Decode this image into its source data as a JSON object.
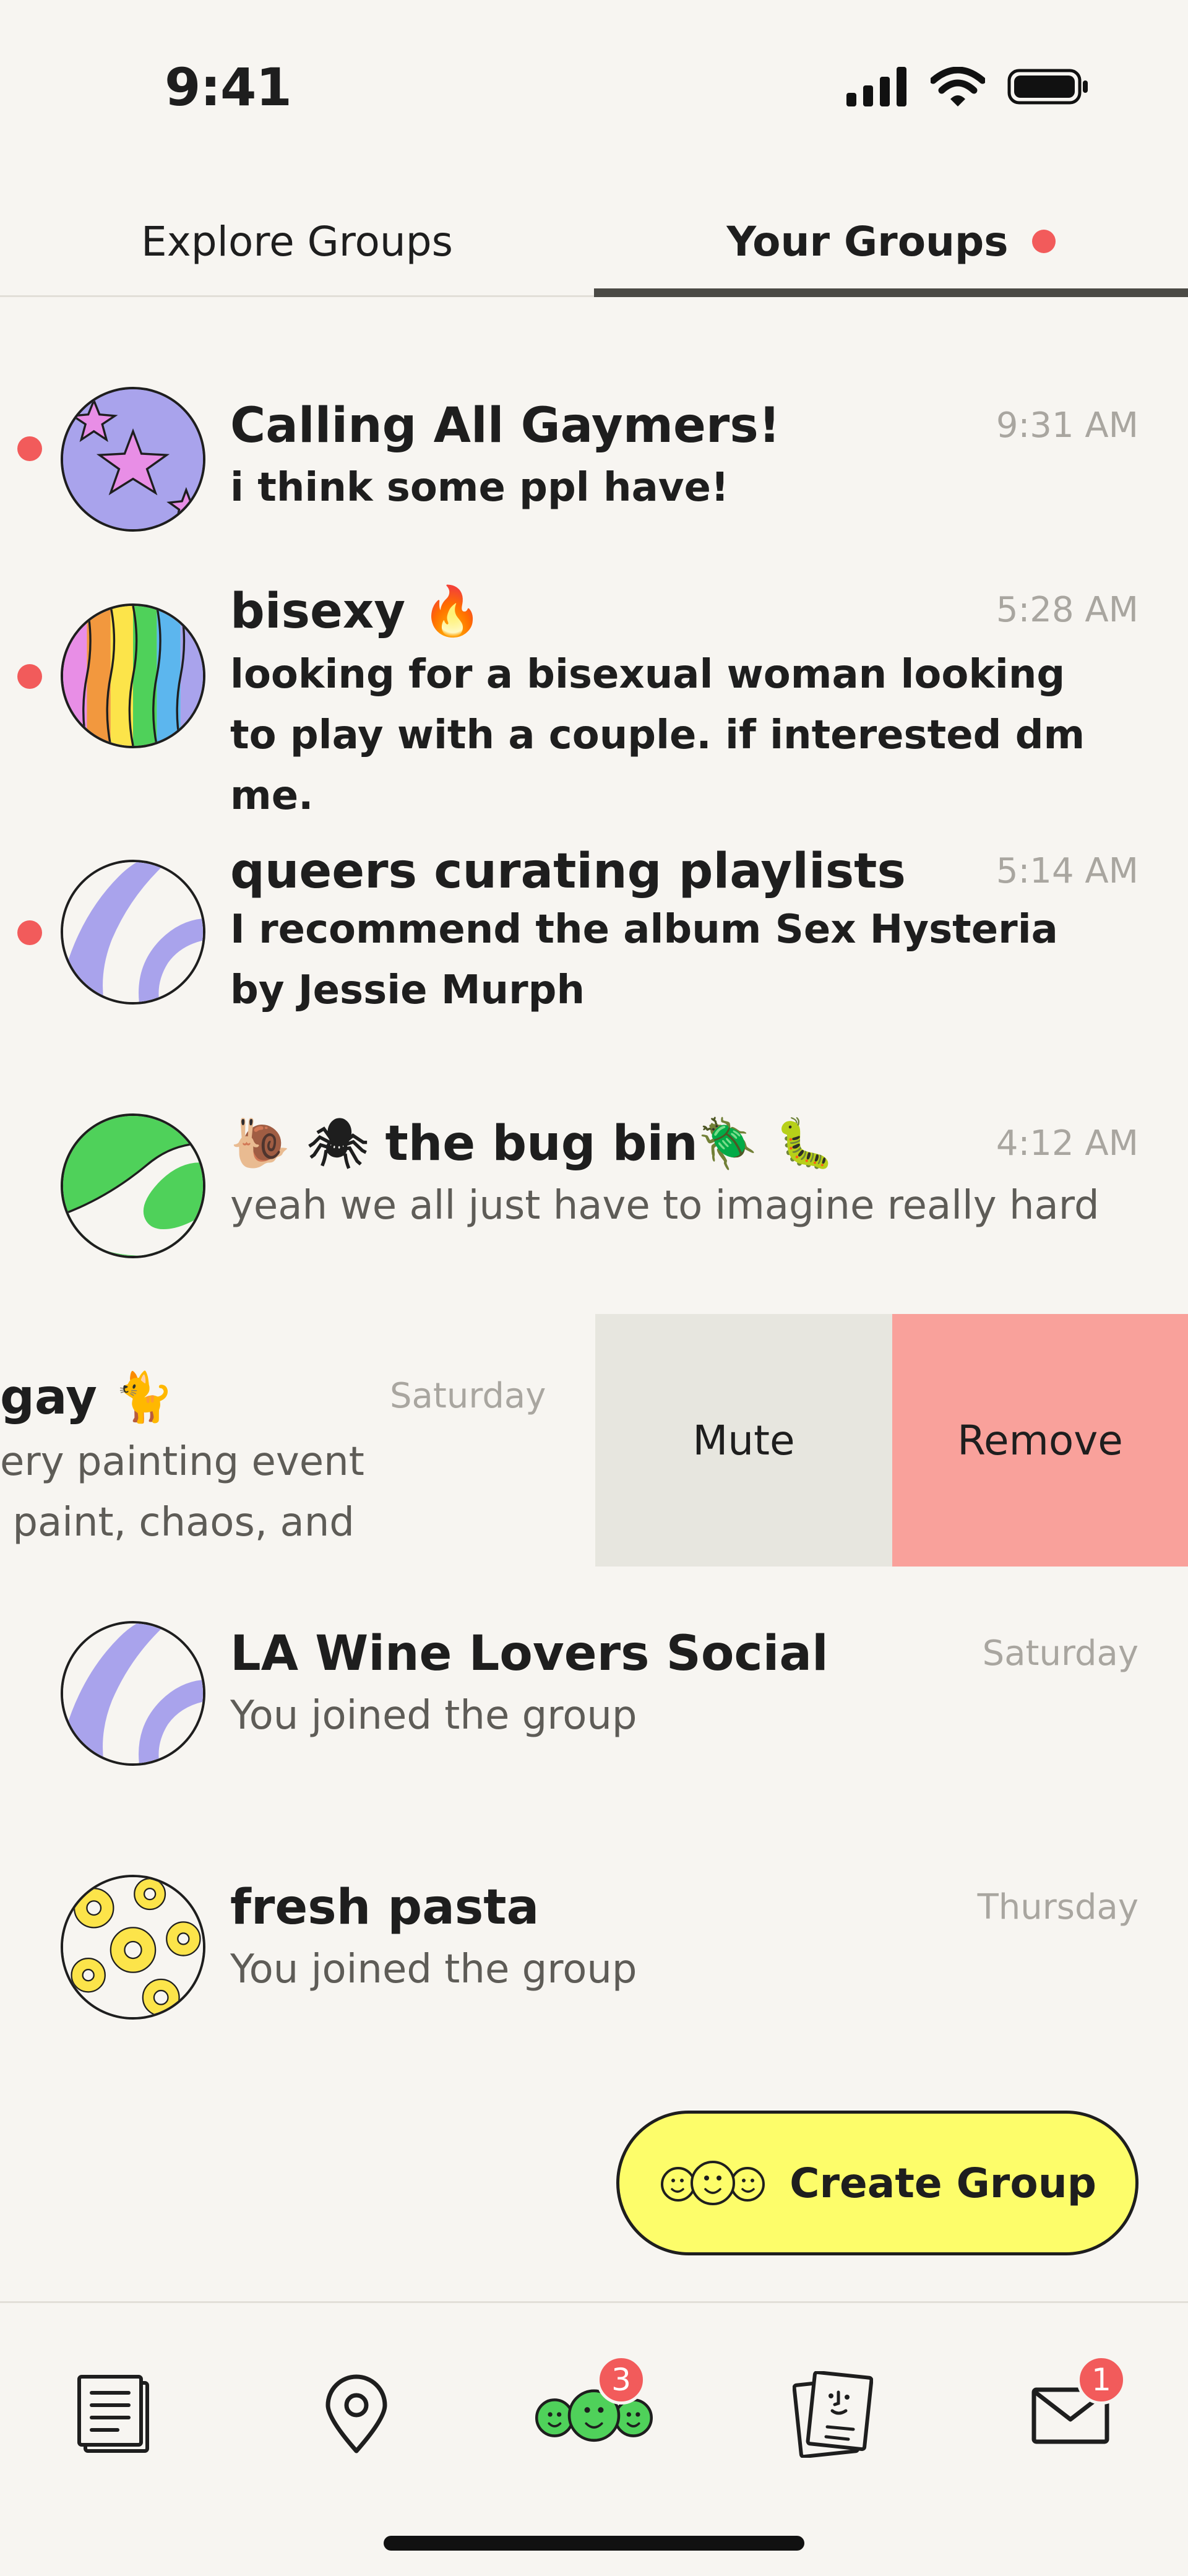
{
  "status_bar": {
    "time": "9:41"
  },
  "tabs": {
    "explore_label": "Explore Groups",
    "yours_label": "Your Groups"
  },
  "groups": [
    {
      "name": "Calling All Gaymers!",
      "time": "9:31 AM",
      "message": "i think some ppl have!",
      "unread": true,
      "avatar": "purple-starfish-icon"
    },
    {
      "name": "bisexy 🔥",
      "time": "5:28 AM",
      "message": "looking for a bisexual woman looking to play with a couple. if interested dm me.",
      "unread": true,
      "avatar": "rainbow-waves-icon"
    },
    {
      "name": "queers curating playlists",
      "time": "5:14 AM",
      "message": "I recommend the album Sex Hysteria by Jessie Murph",
      "unread": true,
      "avatar": "lavender-swirl-icon"
    },
    {
      "name": "🐌 🕷 the bug bin🪲 🐛",
      "time": "4:12 AM",
      "message": "yeah we all just have to imagine really hard",
      "unread": false,
      "avatar": "green-swirl-icon"
    }
  ],
  "swiped_group": {
    "name": "gay 🐈",
    "time": "Saturday",
    "message_line1": "ery painting event",
    "message_line2": " paint, chaos, and",
    "mute_label": "Mute",
    "remove_label": "Remove"
  },
  "groups_after": [
    {
      "name": "LA Wine Lovers Social",
      "time": "Saturday",
      "message": "You joined the group",
      "unread": false,
      "avatar": "lavender-swirl-icon"
    },
    {
      "name": "fresh pasta",
      "time": "Thursday",
      "message": "You joined the group",
      "unread": false,
      "avatar": "yellow-flowers-icon"
    }
  ],
  "create_group": {
    "label": "Create Group",
    "icon": "three-faces-icon"
  },
  "bottom_nav": {
    "items": [
      {
        "icon": "document-icon"
      },
      {
        "icon": "location-pin-icon"
      },
      {
        "icon": "groups-faces-icon",
        "badge": "3"
      },
      {
        "icon": "profile-card-icon"
      },
      {
        "icon": "mail-icon",
        "badge": "1"
      }
    ]
  },
  "colors": {
    "background": "#f7f5f1",
    "unread_dot": "#f25b5b",
    "mute_bg": "#e7e6df",
    "remove_bg": "#f9a19b",
    "create_bg": "#fdfd6a"
  }
}
